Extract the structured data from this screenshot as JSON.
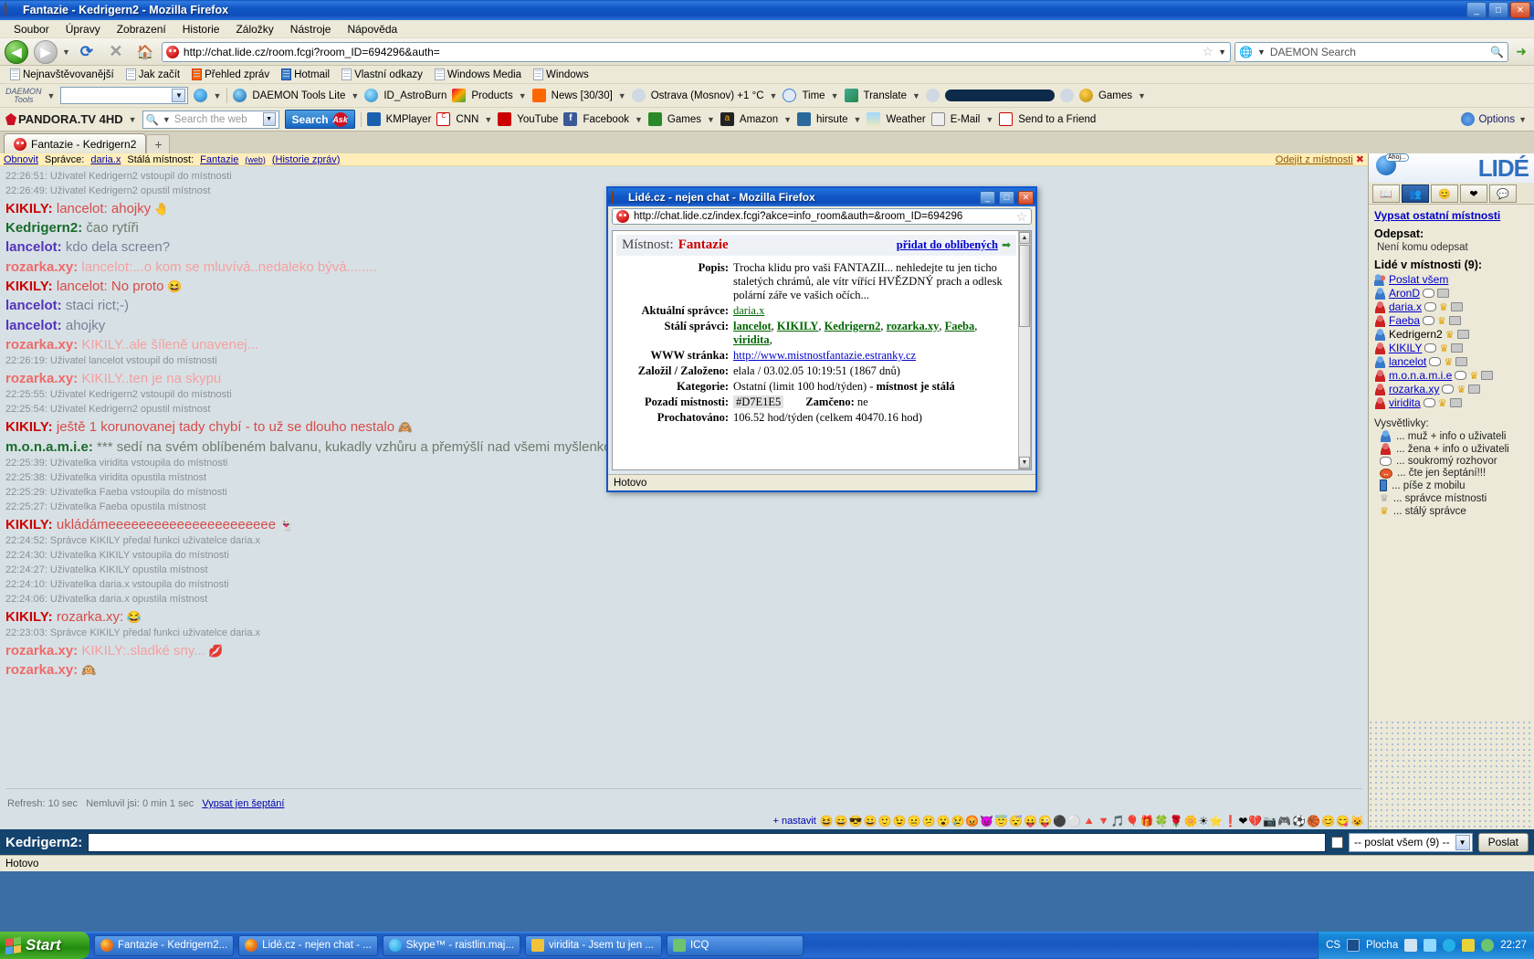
{
  "window": {
    "title": "Fantazie - Kedrigern2 - Mozilla Firefox",
    "min_label": "_",
    "max_label": "□",
    "close_label": "✕"
  },
  "menu": [
    "Soubor",
    "Úpravy",
    "Zobrazení",
    "Historie",
    "Záložky",
    "Nástroje",
    "Nápověda"
  ],
  "nav": {
    "url": "http://chat.lide.cz/room.fcgi?room_ID=694296&auth=",
    "search_placeholder": "DAEMON Search",
    "back_icon": "back-arrow-icon",
    "forward_icon": "forward-arrow-icon",
    "reload_icon": "reload-icon",
    "stop_icon": "stop-icon",
    "home_icon": "home-icon",
    "star_icon": "bookmark-star-icon"
  },
  "bookmarks": [
    "Nejnavštěvovanější",
    "Jak začít",
    "Přehled zpráv",
    "Hotmail",
    "Vlastní odkazy",
    "Windows Media",
    "Windows"
  ],
  "daemon_toolbar": {
    "brand_line1": "DAEMON",
    "brand_line2": "Tools",
    "items": [
      "DAEMON Tools Lite",
      "ID_AstroBurn",
      "Products",
      "News [30/30]",
      "Ostrava (Mosnov) +1 °C",
      "Time",
      "Translate",
      "Games"
    ]
  },
  "pandora_toolbar": {
    "brand": "PANDORA.TV 4HD",
    "search_placeholder": "Search the web",
    "search_button": "Search",
    "ask_badge": "Ask",
    "items": [
      "KMPlayer",
      "CNN",
      "YouTube",
      "Facebook",
      "Games",
      "Amazon",
      "hirsute",
      "Weather",
      "E-Mail",
      "Send to a Friend"
    ],
    "options": "Options"
  },
  "tabs": [
    {
      "label": "Fantazie - Kedrigern2"
    }
  ],
  "new_tab_label": "+",
  "room_bar": {
    "refresh": "Obnovit",
    "admin_label": "Správce:",
    "admin_name": "daria.x",
    "perm_label": "Stálá místnost:",
    "room_name": "Fantazie",
    "web_label": "(web)",
    "history": "(Historie zpráv)",
    "leave": "Odejít z místnosti"
  },
  "chat": [
    {
      "type": "sys",
      "text": "22:26:51: Uživatel Kedrigern2 vstoupil do místnosti"
    },
    {
      "type": "sys",
      "text": "22:26:49: Uživatel Kedrigern2 opustil místnost"
    },
    {
      "type": "msg",
      "nick": "KIKILY",
      "nclass": "n-kikily",
      "tclass": "t-kikily",
      "text": "lancelot: ahojky",
      "emoji": "🤚"
    },
    {
      "type": "msg",
      "nick": "Kedrigern2",
      "nclass": "n-kedrigern",
      "tclass": "t-kedrigern",
      "text": "čao rytíři",
      "emoji": ""
    },
    {
      "type": "msg",
      "nick": "lancelot",
      "nclass": "n-lancelot",
      "tclass": "t-lancelot",
      "text": "kdo dela screen?",
      "emoji": ""
    },
    {
      "type": "msg",
      "nick": "rozarka.xy",
      "nclass": "n-rozarka",
      "tclass": "t-rozarka",
      "text": "lancelot:...o kom se mluvívá..nedaleko bývá........",
      "emoji": ""
    },
    {
      "type": "msg",
      "nick": "KIKILY",
      "nclass": "n-kikily",
      "tclass": "t-kikily",
      "text": "lancelot: No proto",
      "emoji": "😆"
    },
    {
      "type": "msg",
      "nick": "lancelot",
      "nclass": "n-lancelot",
      "tclass": "t-lancelot",
      "text": "staci rict;-)",
      "emoji": ""
    },
    {
      "type": "msg",
      "nick": "lancelot",
      "nclass": "n-lancelot",
      "tclass": "t-lancelot",
      "text": "ahojky",
      "emoji": ""
    },
    {
      "type": "msg",
      "nick": "rozarka.xy",
      "nclass": "n-rozarka",
      "tclass": "t-rozarka",
      "text": "KIKILY..ale šíleně unavenej...",
      "emoji": ""
    },
    {
      "type": "sys",
      "text": "22:26:19: Uživatel lancelot vstoupil do místnosti"
    },
    {
      "type": "msg",
      "nick": "rozarka.xy",
      "nclass": "n-rozarka",
      "tclass": "t-rozarka",
      "text": "KIKILY..ten je na skypu",
      "emoji": ""
    },
    {
      "type": "sys",
      "text": "22:25:55: Uživatel Kedrigern2 vstoupil do místnosti"
    },
    {
      "type": "sys",
      "text": "22:25:54: Uživatel Kedrigern2 opustil místnost"
    },
    {
      "type": "msg",
      "nick": "KIKILY",
      "nclass": "n-kikily",
      "tclass": "t-kikily",
      "text": "ještě 1 korunovanej tady chybí - to už se dlouho nestalo",
      "emoji": "🙈"
    },
    {
      "type": "msg",
      "nick": "m.o.n.a.m.i.e",
      "nclass": "n-mona",
      "tclass": "t-mona",
      "text": "*** sedí na svém oblíbeném balvanu, kukadly vzhůru a přemýšlí nad všemi myšlenkovým",
      "emoji": ""
    },
    {
      "type": "sys",
      "text": "22:25:39: Uživatelka viridita vstoupila do místnosti"
    },
    {
      "type": "sys",
      "text": "22:25:38: Uživatelka viridita opustila místnost"
    },
    {
      "type": "sys",
      "text": "22:25:29: Uživatelka Faeba vstoupila do místnosti"
    },
    {
      "type": "sys",
      "text": "22:25:27: Uživatelka Faeba opustila místnost"
    },
    {
      "type": "msg",
      "nick": "KIKILY",
      "nclass": "n-kikily",
      "tclass": "t-kikily",
      "text": "ukládámeeeeeeeeeeeeeeeeeeeeee",
      "emoji": "👻"
    },
    {
      "type": "sys",
      "text": "22:24:52: Správce KIKILY předal funkci uživatelce daria.x"
    },
    {
      "type": "sys",
      "text": "22:24:30: Uživatelka KIKILY vstoupila do místnosti"
    },
    {
      "type": "sys",
      "text": "22:24:27: Uživatelka KIKILY opustila místnost"
    },
    {
      "type": "sys",
      "text": "22:24:10: Uživatelka daria.x vstoupila do místnosti"
    },
    {
      "type": "sys",
      "text": "22:24:06: Uživatelka daria.x opustila místnost"
    },
    {
      "type": "msg",
      "nick": "KIKILY",
      "nclass": "n-kikily",
      "tclass": "t-kikily",
      "text": "rozarka.xy:",
      "emoji": "😂"
    },
    {
      "type": "sys",
      "text": "22:23:03: Správce KIKILY předal funkci uživatelce daria.x"
    },
    {
      "type": "msg",
      "nick": "rozarka.xy",
      "nclass": "n-rozarka",
      "tclass": "t-rozarka",
      "text": "KIKILY:.sladké sny...",
      "emoji": "💋"
    },
    {
      "type": "msg",
      "nick": "rozarka.xy",
      "nclass": "n-rozarka",
      "tclass": "t-rozarka",
      "text": "",
      "emoji": "🙉"
    }
  ],
  "footer": {
    "refresh_text": "Refresh: 10 sec",
    "idle_text": "Nemluvil jsi: 0 min 1 sec",
    "whisper_link": "Vypsat jen šeptání",
    "nastavit": "+ nastavit"
  },
  "emoticons": [
    "😆",
    "😄",
    "😎",
    "😀",
    "🙂",
    "😉",
    "😐",
    "😕",
    "😮",
    "😢",
    "😡",
    "😈",
    "😇",
    "😴",
    "😛",
    "😜",
    "⚫",
    "⚪",
    "🔺",
    "🔻",
    "🎵",
    "🎈",
    "🎁",
    "🍀",
    "🌹",
    "🌼",
    "☀",
    "⭐",
    "❗",
    "❤",
    "💔",
    "📷",
    "🎮",
    "⚽",
    "🏀",
    "😊",
    "😋",
    "😺"
  ],
  "input_bar": {
    "user_label": "Kedrigern2:",
    "value": "",
    "target_select": "-- poslat všem (9) --",
    "send_button": "Poslat"
  },
  "status_bar": {
    "text": "Hotovo"
  },
  "sidebar": {
    "logo_text": "LIDÉ",
    "bubble_text": "Ahoj...",
    "tabs": [
      "book-icon",
      "people-icon",
      "smiley-icon",
      "heart-icon",
      "chat-icon"
    ],
    "list_other_rooms": "Vypsat ostatní místnosti",
    "reply_heading": "Odepsat:",
    "reply_none": "Není komu odepsat",
    "people_heading": "Lidé v místnosti (9):",
    "send_all": "Poslat všem",
    "users": [
      {
        "name": "AronD",
        "gender": "m",
        "bubble": true,
        "crown": false,
        "cam": true,
        "link": true
      },
      {
        "name": "daria.x",
        "gender": "f",
        "bubble": true,
        "crown": true,
        "cam": true,
        "link": true
      },
      {
        "name": "Faeba",
        "gender": "f",
        "bubble": true,
        "crown": true,
        "cam": true,
        "link": true
      },
      {
        "name": "Kedrigern2",
        "gender": "m",
        "bubble": false,
        "crown": true,
        "cam": true,
        "link": false
      },
      {
        "name": "KIKILY",
        "gender": "f",
        "bubble": true,
        "crown": true,
        "cam": true,
        "link": true
      },
      {
        "name": "lancelot",
        "gender": "m",
        "bubble": true,
        "crown": true,
        "cam": true,
        "link": true
      },
      {
        "name": "m.o.n.a.m.i.e",
        "gender": "f",
        "bubble": true,
        "crown": true,
        "cam": true,
        "link": true
      },
      {
        "name": "rozarka.xy",
        "gender": "f",
        "bubble": true,
        "crown": true,
        "cam": true,
        "link": true
      },
      {
        "name": "viridita",
        "gender": "f",
        "bubble": true,
        "crown": true,
        "cam": true,
        "link": true
      }
    ],
    "legend_heading": "Vysvětlivky:",
    "legend": [
      {
        "icon": "male-user-icon",
        "text": "... muž + info o uživateli"
      },
      {
        "icon": "female-user-icon",
        "text": "... žena + info o uživateli"
      },
      {
        "icon": "speech-bubble-icon",
        "text": "... soukromý rozhovor"
      },
      {
        "icon": "whisper-icon",
        "text": "... čte jen šeptání!!!"
      },
      {
        "icon": "mobile-phone-icon",
        "text": "... píše z mobilu"
      },
      {
        "icon": "crown-silver-icon",
        "text": "... správce místnosti"
      },
      {
        "icon": "crown-gold-icon",
        "text": "... stálý správce"
      }
    ]
  },
  "popup": {
    "title": "Lidé.cz - nejen chat - Mozilla Firefox",
    "url": "http://chat.lide.cz/index.fcgi?akce=info_room&auth=&room_ID=694296",
    "room_label": "Místnost:",
    "room_name": "Fantazie",
    "favorite_link": "přidat do oblíbených",
    "rows": [
      {
        "key": "Popis:",
        "value": "Trocha klidu pro vaši FANTAZII... nehledejte tu jen ticho staletých chrámů, ale vítr vířící HVĚZDNÝ prach a odlesk polární záře ve vašich očích...",
        "kind": "text"
      },
      {
        "key": "Aktuální správce:",
        "value": "daria.x",
        "kind": "link-green-plain"
      },
      {
        "key": "Stálí správci:",
        "value": "lancelot, KIKILY, Kedrigern2, rozarka.xy, Faeba, viridita,",
        "kind": "links-green"
      },
      {
        "key": "WWW stránka:",
        "value": "http://www.mistnostfantazie.estranky.cz",
        "kind": "link-blue"
      },
      {
        "key": "Založil / Založeno:",
        "value": "elala / 03.02.05 10:19:51 (1867 dnů)",
        "kind": "text"
      },
      {
        "key": "Kategorie:",
        "value": "Ostatní (limit 100 hod/týden) - místnost je stálá",
        "kind": "text-bold-tail"
      },
      {
        "key": "Pozadí místnosti:",
        "value": "#D7E1E5",
        "kind": "swatch",
        "extra_key": "Zamčeno:",
        "extra_value": "ne"
      },
      {
        "key": "Prochatováno:",
        "value": "106.52 hod/týden (celkem 40470.16 hod)",
        "kind": "text"
      }
    ],
    "admins": [
      "lancelot",
      "KIKILY",
      "Kedrigern2",
      "rozarka.xy",
      "Faeba",
      "viridita"
    ],
    "status": "Hotovo",
    "min_label": "_",
    "max_label": "□",
    "close_label": "✕"
  },
  "taskbar": {
    "start": "Start",
    "tasks": [
      {
        "label": "Fantazie - Kedrigern2...",
        "icon": "firefox-icon"
      },
      {
        "label": "Lidé.cz - nejen chat - ...",
        "icon": "firefox-icon"
      },
      {
        "label": "Skype™ - raistlin.maj...",
        "icon": "skype-icon"
      },
      {
        "label": "viridita - Jsem tu jen ...",
        "icon": "note-icon"
      },
      {
        "label": "ICQ",
        "icon": "icq-icon"
      }
    ],
    "tray": {
      "lang": "CS",
      "desktop": "Plocha",
      "clock": "22:27"
    }
  }
}
